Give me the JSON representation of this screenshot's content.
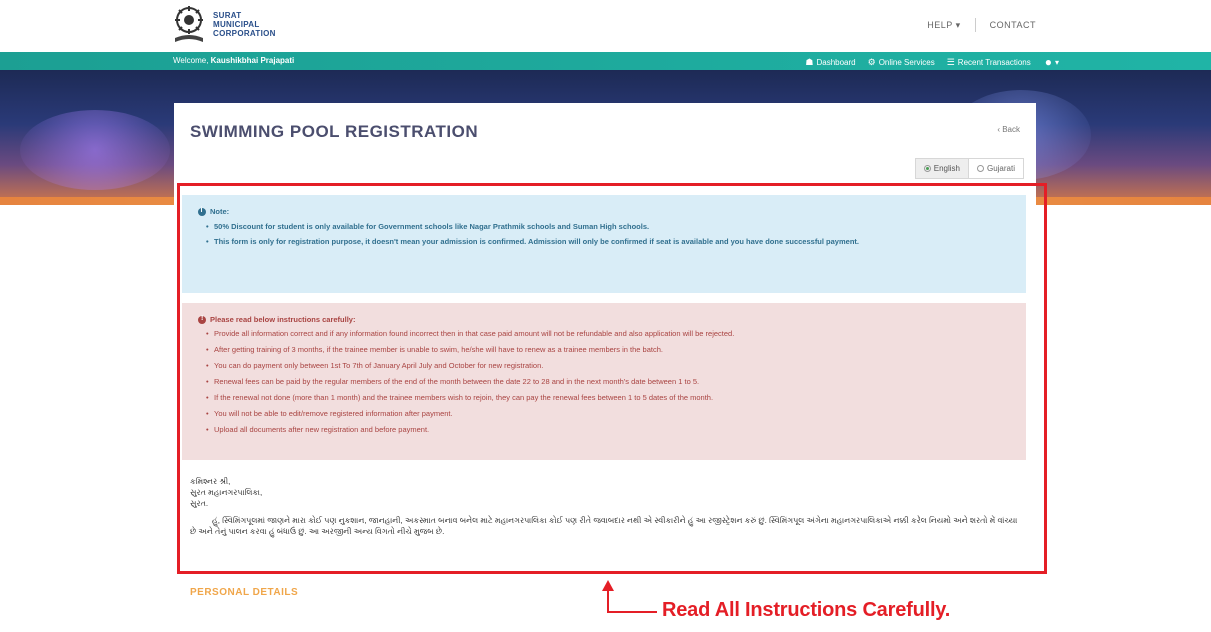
{
  "header": {
    "logo_lines": [
      "SURAT",
      "MUNICIPAL",
      "CORPORATION"
    ],
    "help_label": "HELP",
    "contact_label": "CONTACT"
  },
  "navbar": {
    "welcome_prefix": "Welcome,",
    "user_name": "Kaushikbhai Prajapati",
    "items": [
      {
        "icon": "dashboard-icon",
        "label": "Dashboard"
      },
      {
        "icon": "gear-icon",
        "label": "Online Services"
      },
      {
        "icon": "list-icon",
        "label": "Recent Transactions"
      }
    ]
  },
  "page": {
    "title": "SWIMMING POOL REGISTRATION",
    "back_label": "‹ Back",
    "languages": [
      {
        "label": "English",
        "selected": true
      },
      {
        "label": "Gujarati",
        "selected": false
      }
    ]
  },
  "note": {
    "heading": "Note:",
    "items": [
      "50% Discount for student is only available for Government schools like Nagar Prathmik schools and Suman High schools.",
      "This form is only for registration purpose, it doesn't mean your admission is confirmed. Admission will only be confirmed if seat is available and you have done successful payment."
    ]
  },
  "instructions": {
    "heading": "Please read below instructions carefully:",
    "items": [
      "Provide all information correct and if any information found incorrect then in that case paid amount will not be refundable and also application will be rejected.",
      "After getting training of 3 months, if the trainee member is unable to swim, he/she will have to renew as a trainee members in the batch.",
      "You can do payment only between 1st To 7th of January April July and October for new registration.",
      "Renewal fees can be paid by the regular members of the end of the month between the date 22 to 28 and in the next month's date between 1 to 5.",
      "If the renewal not done (more than 1 month) and the trainee members wish to rejoin, they can pay the renewal fees between 1 to 5 dates of the month.",
      "You will not be able to edit/remove registered information after payment.",
      "Upload all documents after new registration and before payment."
    ]
  },
  "gujarati_letter": {
    "lines": [
      "કમિશ્નર શ્રી,",
      "સુરત મહાનગરપાલિકા,",
      "સુરત."
    ],
    "body": "હું, સ્વિમિંગપૂલમાં જાણને મારા કોઈ પણ નુકશાન, જાનહાની, અકસ્માત બનાવ બનેલ માટે મહાનગરપાલિકા કોઈ પણ રીતે જવાબદાર નથી એ સ્વીકારીને હું આ રજીસ્ટ્રેશન કરું છું. સ્વિમિંગપૂલ અંગેના મહાનગરપાલિકાએ નક્કી કરેલ નિયમો અને શરતો મેં વાંચ્યા છે અને તેનું પાલન કરવા હું બંધાઉં છું. આ અરજીની અન્ય વિગતો નીચે મુજબ છે."
  },
  "section": {
    "personal_details": "PERSONAL DETAILS"
  },
  "annotation": {
    "text": "Read All Instructions Carefully.",
    "color": "#e41e26"
  }
}
